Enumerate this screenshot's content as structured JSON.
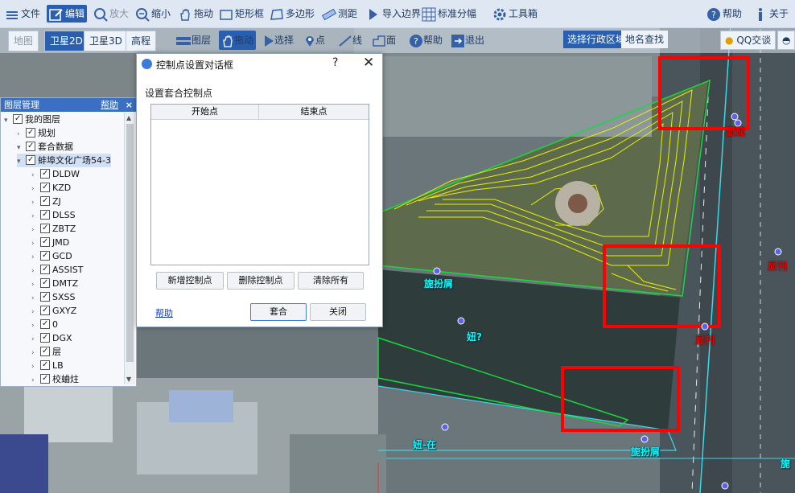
{
  "toolbar": {
    "file": "文件",
    "edit": "编辑",
    "zoom_in": "放大",
    "zoom_out": "缩小",
    "pan": "拖动",
    "rect": "矩形框",
    "polygon": "多边形",
    "measure": "测距",
    "import_boundary": "导入边界",
    "grid": "标准分幅",
    "toolbox": "工具箱",
    "help": "帮助",
    "about": "关于"
  },
  "basemap_tabs": [
    "地图",
    "卫星2D",
    "卫星3D",
    "高程"
  ],
  "toolbar2": {
    "layers": "图层",
    "pan": "拖动",
    "select": "选择",
    "point": "点",
    "line": "线",
    "polygon": "面",
    "help": "帮助",
    "exit": "退出"
  },
  "right_tabs": {
    "region": "选择行政区域",
    "place_search": "地名查找",
    "qq": "QQ交谈"
  },
  "layer_panel": {
    "title": "图层管理",
    "help": "帮助",
    "close": "×",
    "items": [
      {
        "label": "我的图层",
        "level": 0,
        "expanded": true
      },
      {
        "label": "规划",
        "level": 1,
        "expanded": false
      },
      {
        "label": "套合数据",
        "level": 1,
        "expanded": true
      },
      {
        "label": "蚌埠文化广场54-3",
        "level": 2,
        "expanded": true
      },
      {
        "label": "DLDW",
        "level": 3
      },
      {
        "label": "KZD",
        "level": 3
      },
      {
        "label": "ZJ",
        "level": 3
      },
      {
        "label": "DLSS",
        "level": 3
      },
      {
        "label": "ZBTZ",
        "level": 3
      },
      {
        "label": "JMD",
        "level": 3
      },
      {
        "label": "GCD",
        "level": 3
      },
      {
        "label": "ASSIST",
        "level": 3
      },
      {
        "label": "DMTZ",
        "level": 3
      },
      {
        "label": "SXSS",
        "level": 3
      },
      {
        "label": "GXYZ",
        "level": 3
      },
      {
        "label": "0",
        "level": 3
      },
      {
        "label": "DGX",
        "level": 3
      },
      {
        "label": "层",
        "level": 3
      },
      {
        "label": "LB",
        "level": 3
      },
      {
        "label": "校蛐炷",
        "level": 3
      }
    ]
  },
  "dialog": {
    "title": "控制点设置对话框",
    "question": "?",
    "close": "✕",
    "subtitle": "设置套合控制点",
    "columns": [
      "开始点",
      "结束点"
    ],
    "btn_add": "新增控制点",
    "btn_delete": "删除控制点",
    "btn_clear": "清除所有",
    "help": "帮助",
    "btn_fit": "套合",
    "btn_close": "关闭"
  },
  "map_labels": {
    "a": "旎扮屑",
    "b": "妞?",
    "c": "旎扮屑",
    "d": "妞-在",
    "e": "旎",
    "red1": "显现",
    "red2": "显刊",
    "red3": "显刊",
    "red4": "显现"
  },
  "colors": {
    "toolbar_bg": "#dfe7f2",
    "accent": "#2a5fb0",
    "highlight_box": "#ff0000",
    "contour": "#e8f000",
    "boundary": "#18d840",
    "road_line": "#3ad8e8"
  }
}
